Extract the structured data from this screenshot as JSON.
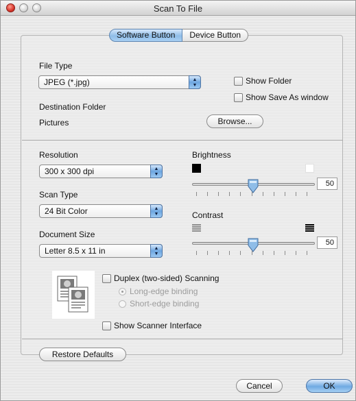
{
  "window": {
    "title": "Scan To File"
  },
  "tabs": [
    {
      "label": "Software Button",
      "active": true
    },
    {
      "label": "Device Button",
      "active": false
    }
  ],
  "file": {
    "type_label": "File Type",
    "type_value": "JPEG (*.jpg)",
    "show_folder_label": "Show Folder",
    "show_folder_checked": false,
    "show_save_as_label": "Show Save As window",
    "show_save_as_checked": false,
    "dest_label": "Destination Folder",
    "dest_value": "Pictures",
    "browse_label": "Browse..."
  },
  "scan": {
    "resolution_label": "Resolution",
    "resolution_value": "300 x 300 dpi",
    "scan_type_label": "Scan Type",
    "scan_type_value": "24 Bit Color",
    "doc_size_label": "Document Size",
    "doc_size_value": "Letter  8.5 x 11 in",
    "brightness_label": "Brightness",
    "brightness_value": "50",
    "contrast_label": "Contrast",
    "contrast_value": "50",
    "slider_range": [
      0,
      100
    ]
  },
  "duplex": {
    "label": "Duplex (two-sided) Scanning",
    "checked": false,
    "long_edge_label": "Long-edge binding",
    "long_edge_selected": true,
    "short_edge_label": "Short-edge binding",
    "short_edge_selected": false
  },
  "scanner_interface": {
    "label": "Show Scanner Interface",
    "checked": false
  },
  "buttons": {
    "restore_label": "Restore Defaults",
    "cancel_label": "Cancel",
    "ok_label": "OK"
  },
  "colors": {
    "accent": "#6fa9e2",
    "dim_text": "#9c9c9c"
  },
  "icons": {
    "brightness_low": "black-square-icon",
    "brightness_high": "white-square-icon",
    "contrast_low": "low-contrast-lines-icon",
    "contrast_high": "high-contrast-lines-icon",
    "duplex": "duplex-pages-icon"
  }
}
